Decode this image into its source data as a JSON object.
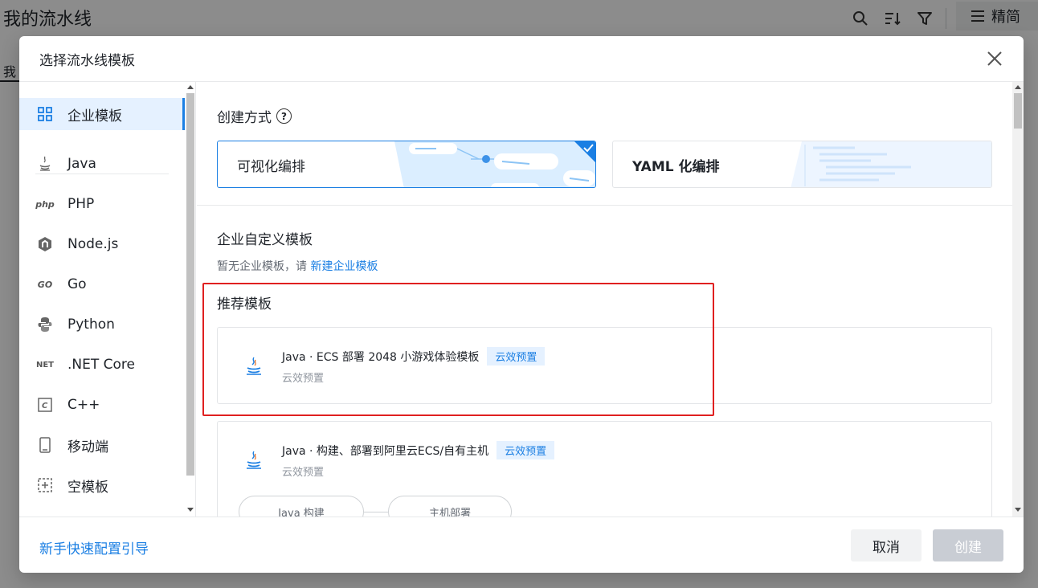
{
  "background": {
    "page_title": "我的流水线",
    "compact_label": "精简",
    "tab_label": "我"
  },
  "modal": {
    "title": "选择流水线模板",
    "sidebar": {
      "items": [
        {
          "label": "企业模板",
          "icon": "grid-icon",
          "active": true
        },
        {
          "label": "Java",
          "icon": "java-icon"
        },
        {
          "label": "PHP",
          "icon": "php-icon",
          "icon_text": "php"
        },
        {
          "label": "Node.js",
          "icon": "nodejs-icon"
        },
        {
          "label": "Go",
          "icon": "go-icon",
          "icon_text": "GO"
        },
        {
          "label": "Python",
          "icon": "python-icon"
        },
        {
          "label": ".NET Core",
          "icon": "dotnet-icon",
          "icon_text": "NET"
        },
        {
          "label": "C++",
          "icon": "cpp-icon",
          "icon_text": "C"
        },
        {
          "label": "移动端",
          "icon": "mobile-icon"
        },
        {
          "label": "空模板",
          "icon": "empty-template-icon"
        }
      ]
    },
    "create_mode": {
      "title": "创建方式",
      "options": [
        {
          "label": "可视化编排",
          "selected": true
        },
        {
          "label": "YAML 化编排",
          "selected": false
        }
      ]
    },
    "enterprise": {
      "title": "企业自定义模板",
      "hint_prefix": "暂无企业模板，请",
      "hint_link": "新建企业模板"
    },
    "recommended": {
      "title": "推荐模板",
      "templates": [
        {
          "name": "Java · ECS 部署 2048 小游戏体验模板",
          "tag": "云效预置",
          "sub": "云效预置"
        },
        {
          "name": "Java · 构建、部署到阿里云ECS/自有主机",
          "tag": "云效预置",
          "sub": "云效预置",
          "stages": [
            "Java 构建",
            "主机部署"
          ]
        }
      ]
    },
    "footer": {
      "guide_link": "新手快速配置引导",
      "cancel_label": "取消",
      "create_label": "创建"
    }
  },
  "colors": {
    "accent": "#1b7fe3",
    "highlight": "#e02020"
  }
}
